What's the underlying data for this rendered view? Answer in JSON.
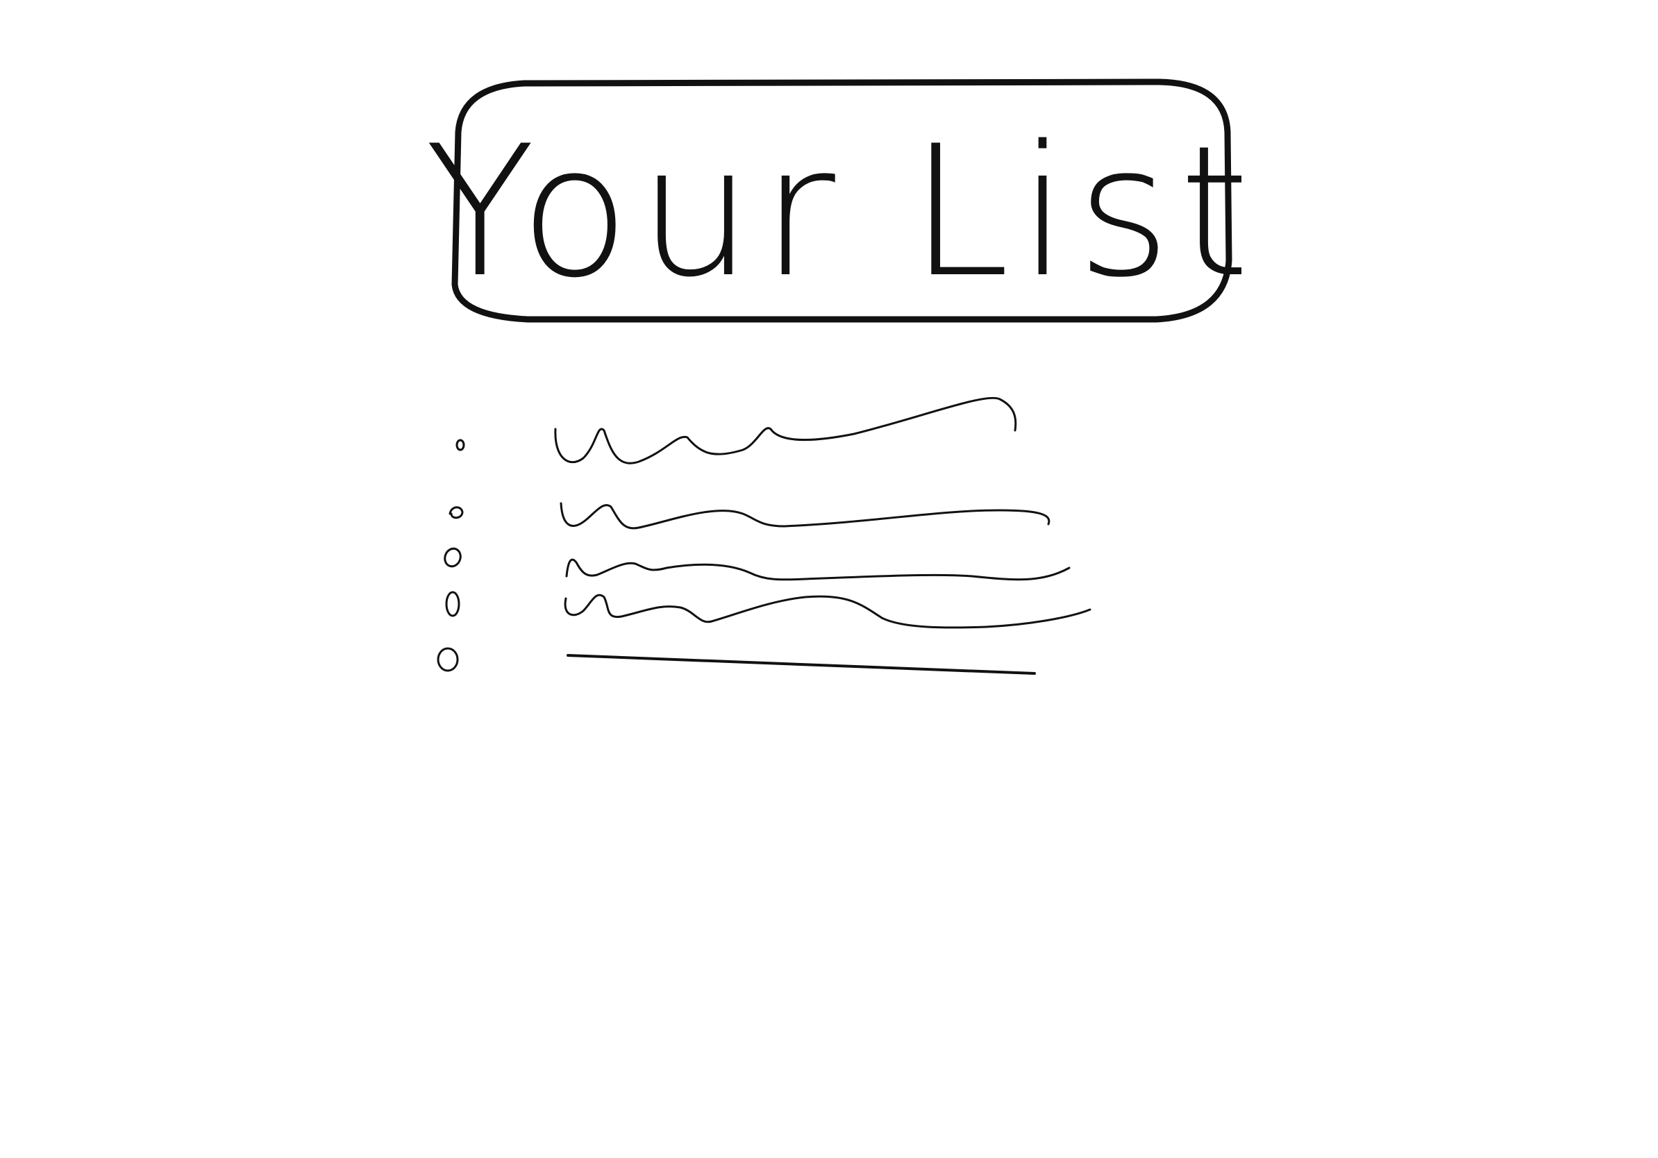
{
  "header": {
    "title": "Your List"
  },
  "list": {
    "item_count": 5
  },
  "colors": {
    "ink": "#111111",
    "background": "#ffffff"
  }
}
